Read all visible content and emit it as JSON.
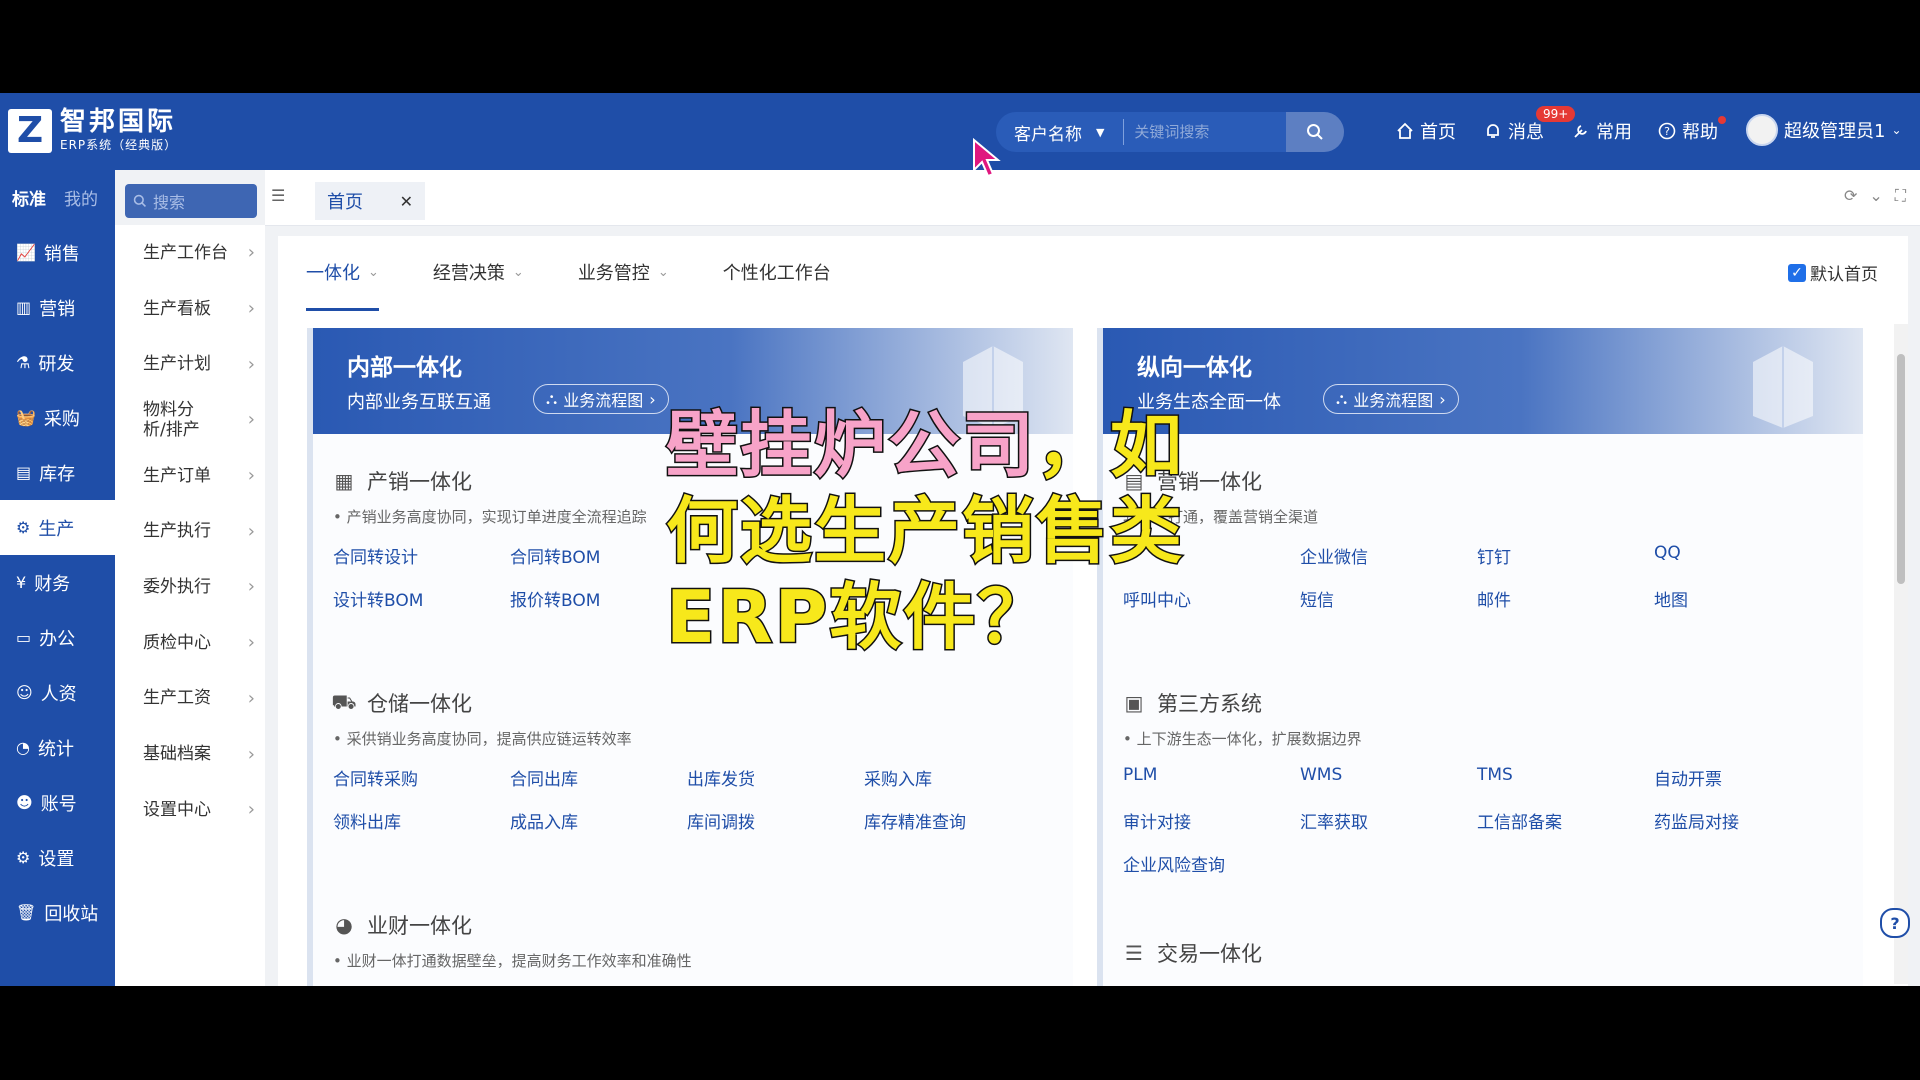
{
  "header": {
    "logo_letter": "Z",
    "logo_name": "智邦国际",
    "logo_sub": "ERP系统（经典版）",
    "search_select": "客户名称",
    "search_placeholder": "关键词搜索",
    "nav_home": "首页",
    "nav_messages": "消息",
    "messages_badge": "99+",
    "nav_common": "常用",
    "nav_help": "帮助",
    "user_name": "超级管理员1"
  },
  "sidebar": {
    "tab_standard": "标准",
    "tab_mine": "我的",
    "search_placeholder": "搜索",
    "items": [
      {
        "label": "销售",
        "icon": "sales-chart-icon"
      },
      {
        "label": "营销",
        "icon": "bar-chart-icon"
      },
      {
        "label": "研发",
        "icon": "rd-icon"
      },
      {
        "label": "采购",
        "icon": "basket-icon"
      },
      {
        "label": "库存",
        "icon": "inventory-icon"
      },
      {
        "label": "生产",
        "icon": "production-icon"
      },
      {
        "label": "财务",
        "icon": "yen-icon"
      },
      {
        "label": "办公",
        "icon": "briefcase-icon"
      },
      {
        "label": "人资",
        "icon": "people-icon"
      },
      {
        "label": "统计",
        "icon": "pie-icon"
      },
      {
        "label": "账号",
        "icon": "user-icon"
      },
      {
        "label": "设置",
        "icon": "gear-icon"
      },
      {
        "label": "回收站",
        "icon": "trash-icon"
      }
    ],
    "active_item": "生产"
  },
  "submenu": [
    "生产工作台",
    "生产看板",
    "生产计划",
    "物料分析/排产",
    "生产订单",
    "生产执行",
    "委外执行",
    "质检中心",
    "生产工资",
    "基础档案",
    "设置中心"
  ],
  "tabs": {
    "home": "首页"
  },
  "subtabs": [
    "一体化",
    "经营决策",
    "业务管控",
    "个性化工作台"
  ],
  "default_home": "默认首页",
  "left_card": {
    "title": "内部一体化",
    "subtitle": "内部业务互联互通",
    "flow_btn": "业务流程图",
    "sections": [
      {
        "title": "产销一体化",
        "desc": "• 产销业务高度协同，实现订单进度全流程追踪",
        "links": [
          "合同转设计",
          "合同转BOM",
          "",
          "",
          "设计转BOM",
          "报价转BOM"
        ]
      },
      {
        "title": "仓储一体化",
        "desc": "• 采供销业务高度协同，提高供应链运转效率",
        "links": [
          "合同转采购",
          "合同出库",
          "出库发货",
          "采购入库",
          "领料出库",
          "成品入库",
          "库间调拨",
          "库存精准查询"
        ]
      },
      {
        "title": "业财一体化",
        "desc": "• 业财一体打通数据壁垒，提高财务工作效率和准确性"
      }
    ]
  },
  "right_card": {
    "title": "纵向一体化",
    "subtitle": "业务生态全面一体",
    "flow_btn": "业务流程图",
    "sections": [
      {
        "title": "营销一体化",
        "desc": "软件全打通，覆盖营销全渠道",
        "links": [
          "",
          "企业微信",
          "钉钉",
          "QQ",
          "呼叫中心",
          "短信",
          "邮件",
          "地图"
        ]
      },
      {
        "title": "第三方系统",
        "desc": "• 上下游生态一体化，扩展数据边界",
        "links": [
          "PLM",
          "WMS",
          "TMS",
          "自动开票",
          "审计对接",
          "汇率获取",
          "工信部备案",
          "药监局对接",
          "企业风险查询"
        ]
      },
      {
        "title": "交易一体化"
      }
    ]
  },
  "overlay": {
    "line1_pink": "壁挂炉公司",
    "line1_yellow": "，如",
    "line2": "何选生产销售类",
    "line3": "ERP软件？"
  },
  "colors": {
    "brand": "#1f4ea8",
    "overlay_yellow": "#f7e81b",
    "overlay_pink": "#f7a3c8"
  }
}
